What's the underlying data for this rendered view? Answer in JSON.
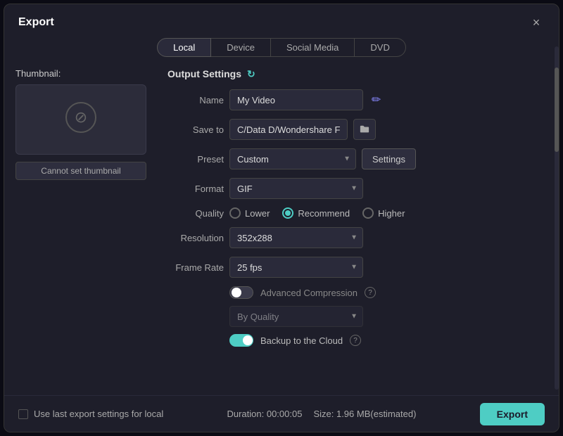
{
  "dialog": {
    "title": "Export",
    "close_label": "×"
  },
  "tabs": [
    {
      "id": "local",
      "label": "Local",
      "active": true
    },
    {
      "id": "device",
      "label": "Device",
      "active": false
    },
    {
      "id": "social-media",
      "label": "Social Media",
      "active": false
    },
    {
      "id": "dvd",
      "label": "DVD",
      "active": false
    }
  ],
  "left": {
    "thumbnail_label": "Thumbnail:",
    "cannot_set_label": "Cannot set thumbnail"
  },
  "right": {
    "section_title": "Output Settings",
    "name_label": "Name",
    "name_value": "My Video",
    "save_to_label": "Save to",
    "save_to_value": "C/Data D/Wondershare Filmc",
    "preset_label": "Preset",
    "preset_value": "Custom",
    "settings_label": "Settings",
    "format_label": "Format",
    "format_value": "GIF",
    "quality_label": "Quality",
    "quality_options": [
      {
        "id": "lower",
        "label": "Lower",
        "checked": false
      },
      {
        "id": "recommend",
        "label": "Recommend",
        "checked": true
      },
      {
        "id": "higher",
        "label": "Higher",
        "checked": false
      }
    ],
    "resolution_label": "Resolution",
    "resolution_value": "352x288",
    "framerate_label": "Frame Rate",
    "framerate_value": "25 fps",
    "advanced_compression_label": "Advanced Compression",
    "advanced_toggle_on": false,
    "by_quality_value": "By Quality",
    "backup_label": "Backup to the Cloud",
    "backup_toggle_on": true
  },
  "footer": {
    "use_last_label": "Use last export settings for local",
    "duration_label": "Duration: 00:00:05",
    "size_label": "Size: 1.96 MB(estimated)",
    "export_label": "Export"
  }
}
